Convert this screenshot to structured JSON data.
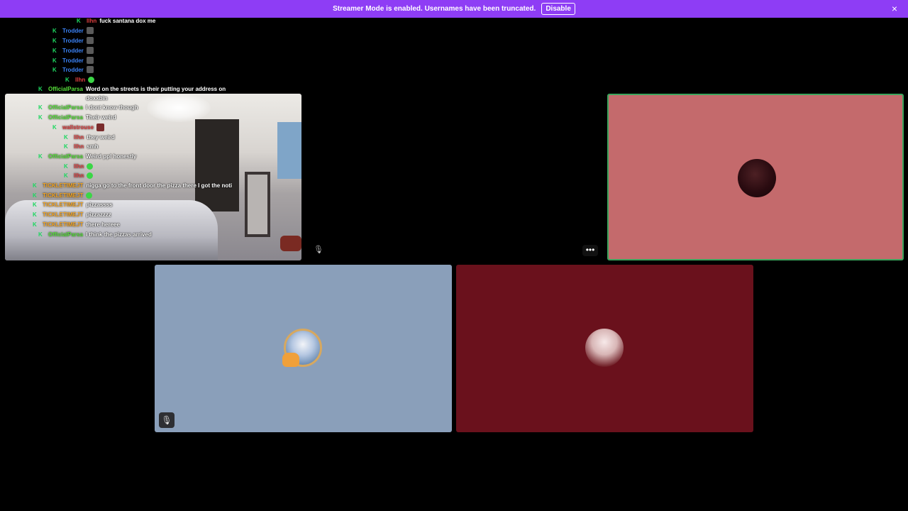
{
  "banner": {
    "text": "Streamer Mode is enabled. Usernames have been truncated.",
    "disable_label": "Disable",
    "close_icon": "×",
    "color": "#8e3df5"
  },
  "chat": [
    {
      "k": "K",
      "user": "llhn",
      "user_color": "#e04040",
      "text": "fuck santana"
    },
    {
      "k": "K",
      "user": "llhn",
      "user_color": "#e04040",
      "text": "",
      "emote": "green"
    },
    {
      "k": "K",
      "user": "llhn",
      "user_color": "#e04040",
      "text": "fuck santana dox me"
    },
    {
      "k": "K",
      "user": "Trodder",
      "user_color": "#3b82f6",
      "text": "",
      "emote": "gray"
    },
    {
      "k": "K",
      "user": "Trodder",
      "user_color": "#3b82f6",
      "text": "",
      "emote": "gray"
    },
    {
      "k": "K",
      "user": "Trodder",
      "user_color": "#3b82f6",
      "text": "",
      "emote": "gray"
    },
    {
      "k": "K",
      "user": "Trodder",
      "user_color": "#3b82f6",
      "text": "",
      "emote": "gray"
    },
    {
      "k": "K",
      "user": "Trodder",
      "user_color": "#3b82f6",
      "text": "",
      "emote": "gray"
    },
    {
      "k": "K",
      "user": "llhn",
      "user_color": "#e04040",
      "text": "",
      "emote": "green"
    },
    {
      "k": "K",
      "user": "OfficialParsa",
      "user_color": "#57e03a",
      "text": "Word on the streets is their putting your address on"
    },
    {
      "k": "",
      "user": "",
      "user_color": "#ffffff",
      "text": "doxxbin"
    },
    {
      "k": "K",
      "user": "OfficialParsa",
      "user_color": "#57e03a",
      "text": "I dont know though"
    },
    {
      "k": "K",
      "user": "OfficialParsa",
      "user_color": "#57e03a",
      "text": "Their weird"
    },
    {
      "k": "K",
      "user": "wallstrouse",
      "user_color": "#e04040",
      "text": "",
      "emote": "ava"
    },
    {
      "k": "K",
      "user": "llhn",
      "user_color": "#e04040",
      "text": "they weird"
    },
    {
      "k": "K",
      "user": "llhn",
      "user_color": "#e04040",
      "text": "smh"
    },
    {
      "k": "K",
      "user": "OfficialParsa",
      "user_color": "#57e03a",
      "text": "Weird ppl honestly"
    },
    {
      "k": "K",
      "user": "llhn",
      "user_color": "#e04040",
      "text": "",
      "emote": "green"
    },
    {
      "k": "K",
      "user": "llhn",
      "user_color": "#e04040",
      "text": "",
      "emote": "green"
    },
    {
      "k": "K",
      "user": "TICKLETIMEJT",
      "user_color": "#f5a623",
      "text": "nigga go to the front door the pizza there I got the noti"
    },
    {
      "k": "K",
      "user": "TICKLETIMEJT",
      "user_color": "#f5a623",
      "text": "",
      "emote": "green"
    },
    {
      "k": "K",
      "user": "TICKLETIMEJT",
      "user_color": "#f5a623",
      "text": "pizzassss"
    },
    {
      "k": "K",
      "user": "TICKLETIMEJT",
      "user_color": "#f5a623",
      "text": "pizzazzzz"
    },
    {
      "k": "K",
      "user": "TICKLETIMEJT",
      "user_color": "#f5a623",
      "text": "there hereee"
    },
    {
      "k": "K",
      "user": "OfficialParsa",
      "user_color": "#57e03a",
      "text": "I think the pizzas arrived"
    }
  ],
  "tiles": {
    "pink_color": "#c46a6c",
    "blue_color": "#8a9fba",
    "red_color": "#6a111c",
    "more_label": "•••",
    "mute_icon": "🎙"
  }
}
